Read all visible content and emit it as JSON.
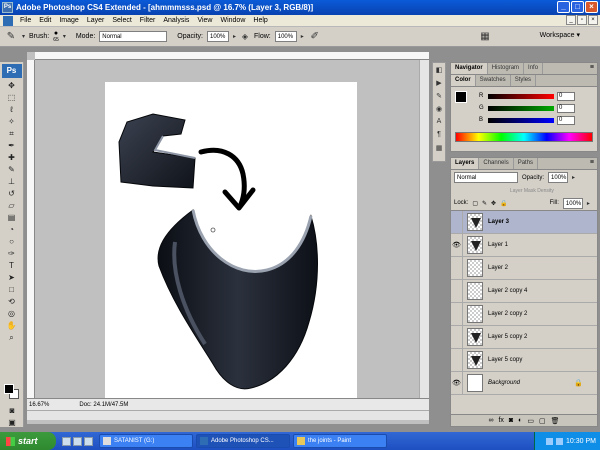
{
  "window": {
    "title": "Adobe Photoshop CS4 Extended - [ahmmmsss.psd @ 16.7% (Layer 3, RGB/8)]",
    "app_badge": "Ps"
  },
  "menu": [
    "File",
    "Edit",
    "Image",
    "Layer",
    "Select",
    "Filter",
    "Analysis",
    "View",
    "Window",
    "Help"
  ],
  "options": {
    "brush_label": "Brush:",
    "brush_size": "65",
    "mode_label": "Mode:",
    "mode_value": "Normal",
    "opacity_label": "Opacity:",
    "opacity_value": "100%",
    "flow_label": "Flow:",
    "flow_value": "100%",
    "workspace_label": "Workspace"
  },
  "document": {
    "zoom": "16.67%",
    "doc_info": "Doc: 24.1M/47.5M"
  },
  "color_panel": {
    "tabs": [
      "Navigator",
      "Histogram",
      "Info"
    ],
    "tabs2": [
      "Color",
      "Swatches",
      "Styles"
    ],
    "channels": [
      {
        "label": "R",
        "value": "0",
        "color": "#ff0000"
      },
      {
        "label": "G",
        "value": "0",
        "color": "#00aa00"
      },
      {
        "label": "B",
        "value": "0",
        "color": "#0000ff"
      }
    ]
  },
  "layers_panel": {
    "tabs": [
      "Layers",
      "Channels",
      "Paths"
    ],
    "blend_mode": "Normal",
    "opacity_label": "Opacity:",
    "opacity_value": "100%",
    "mask_density_label": "Layer Mask Density",
    "lock_label": "Lock:",
    "fill_label": "Fill:",
    "fill_value": "100%",
    "layers": [
      {
        "name": "Layer 3",
        "selected": true,
        "visible": false
      },
      {
        "name": "Layer 1",
        "selected": false,
        "visible": true
      },
      {
        "name": "Layer 2",
        "selected": false,
        "visible": false
      },
      {
        "name": "Layer 2 copy 4",
        "selected": false,
        "visible": false
      },
      {
        "name": "Layer 2 copy 2",
        "selected": false,
        "visible": false
      },
      {
        "name": "Layer 5 copy 2",
        "selected": false,
        "visible": false
      },
      {
        "name": "Layer 5 copy",
        "selected": false,
        "visible": false
      },
      {
        "name": "Background",
        "selected": false,
        "visible": true,
        "locked": true
      }
    ]
  },
  "taskbar": {
    "start_label": "start",
    "tasks": [
      "SATANIST (G:)",
      "Adobe Photoshop CS...",
      "the joints - Paint"
    ],
    "clock": "10:30 PM"
  }
}
